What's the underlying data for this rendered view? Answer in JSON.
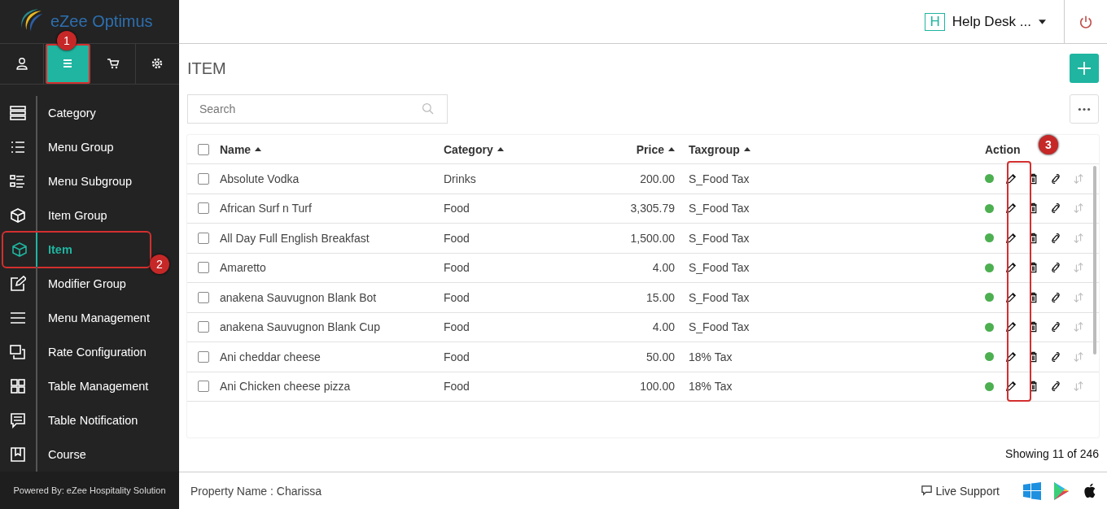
{
  "app": {
    "logo_text": "eZee Optimus",
    "powered_by": "Powered By: eZee Hospitality Solution"
  },
  "sidebar_tabs": [
    {
      "selected": false
    },
    {
      "selected": true,
      "annotation": "1"
    },
    {
      "selected": false
    },
    {
      "selected": false
    }
  ],
  "sidebar_menu": [
    {
      "label": "Category",
      "selected": false
    },
    {
      "label": "Menu Group",
      "selected": false
    },
    {
      "label": "Menu Subgroup",
      "selected": false
    },
    {
      "label": "Item Group",
      "selected": false
    },
    {
      "label": "Item",
      "selected": true,
      "annotation": "2"
    },
    {
      "label": "Modifier Group",
      "selected": false
    },
    {
      "label": "Menu Management",
      "selected": false
    },
    {
      "label": "Rate Configuration",
      "selected": false
    },
    {
      "label": "Table Management",
      "selected": false
    },
    {
      "label": "Table Notification",
      "selected": false
    },
    {
      "label": "Course",
      "selected": false
    }
  ],
  "topbar": {
    "user_initial": "H",
    "user_name": "Help Desk ..."
  },
  "page_title": "ITEM",
  "search": {
    "placeholder": "Search"
  },
  "table": {
    "columns": [
      {
        "label": "Name",
        "sortable": true
      },
      {
        "label": "Category",
        "sortable": true
      },
      {
        "label": "Price",
        "sortable": true
      },
      {
        "label": "Taxgroup",
        "sortable": true
      },
      {
        "label": "Action",
        "sortable": false,
        "annotation": "3"
      }
    ],
    "rows": [
      {
        "checked": false,
        "name": "Absolute Vodka",
        "category": "Drinks",
        "price": "200.00",
        "taxgroup": "S_Food Tax",
        "active": true
      },
      {
        "checked": false,
        "name": "African Surf n Turf",
        "category": "Food",
        "price": "3,305.79",
        "taxgroup": "S_Food Tax",
        "active": true
      },
      {
        "checked": false,
        "name": "All Day Full English Breakfast",
        "category": "Food",
        "price": "1,500.00",
        "taxgroup": "S_Food Tax",
        "active": true
      },
      {
        "checked": false,
        "name": "Amaretto",
        "category": "Food",
        "price": "4.00",
        "taxgroup": "S_Food Tax",
        "active": true
      },
      {
        "checked": false,
        "name": "anakena Sauvugnon Blank Bot",
        "category": "Food",
        "price": "15.00",
        "taxgroup": "S_Food Tax",
        "active": true
      },
      {
        "checked": false,
        "name": "anakena Sauvugnon Blank Cup",
        "category": "Food",
        "price": "4.00",
        "taxgroup": "S_Food Tax",
        "active": true
      },
      {
        "checked": false,
        "name": "Ani cheddar cheese",
        "category": "Food",
        "price": "50.00",
        "taxgroup": "18% Tax",
        "active": true
      },
      {
        "checked": false,
        "name": "Ani Chicken cheese pizza",
        "category": "Food",
        "price": "100.00",
        "taxgroup": "18% Tax",
        "active": true
      }
    ],
    "select_all_checked": false,
    "showing": "Showing 11 of 246"
  },
  "footer": {
    "property": "Property Name : Charissa",
    "support": "Live Support"
  }
}
